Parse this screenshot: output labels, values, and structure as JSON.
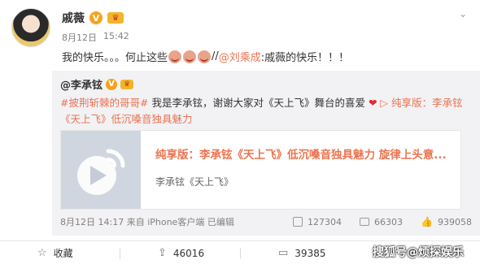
{
  "post": {
    "author": "戚薇",
    "verified_badge": "V",
    "vip_badge": "crown",
    "date": "8月12日",
    "time": "15:42",
    "text_before": "我的快乐。。。何止这些",
    "text_sep": "//",
    "mention": "@刘乘成",
    "text_after": ":戚薇的快乐！！！",
    "menu_icon": "chevron-down-icon"
  },
  "repost": {
    "author": "@李承铉",
    "text_hashtag": "#披荆斩棘的哥哥#",
    "text_body": "我是李承铉，谢谢大家对《天上飞》舞台的喜爱",
    "text_heart": "❤",
    "text_link_icon": "video-link-icon",
    "text_link": "纯享版：李承铉《天上飞》低沉嗓音独具魅力",
    "video": {
      "title": "纯享版：李承铉《天上飞》低沉嗓音独具魅力 旋律上头意...",
      "subtitle": "李承铉《天上飞》"
    },
    "footer": {
      "date": "8月12日",
      "time": "14:17",
      "source": "来自 iPhone客户端",
      "edited": "已编辑",
      "reposts": "127304",
      "comments": "66303",
      "likes": "939058"
    }
  },
  "actions": {
    "favorite": "收藏",
    "repost_count": "46016",
    "comment_count": "39385"
  },
  "watermark": "搜狐号@烦探娱乐"
}
